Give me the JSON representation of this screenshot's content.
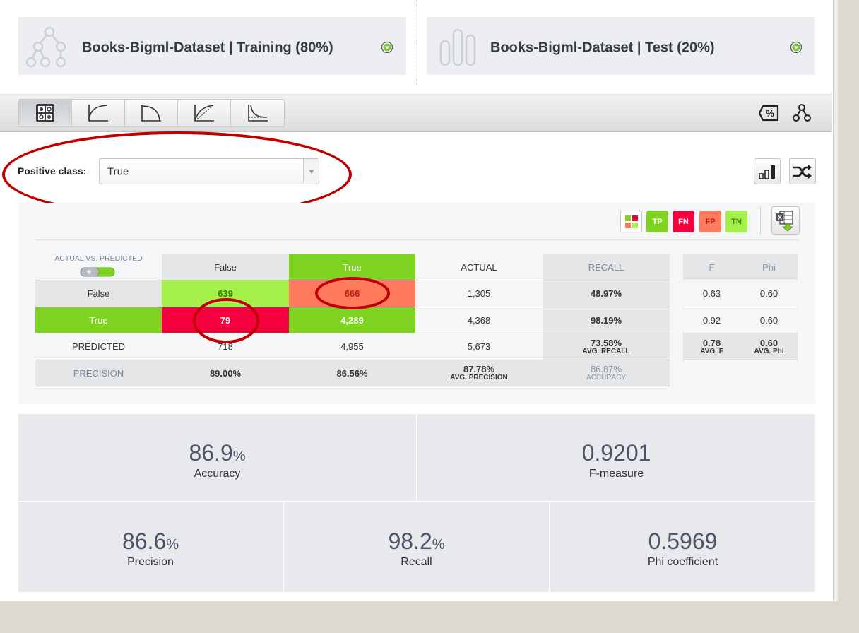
{
  "datasets": {
    "training": {
      "name": "Books-Bigml-Dataset | Training (80%)",
      "icon": "model-tree-icon"
    },
    "test": {
      "name": "Books-Bigml-Dataset | Test (20%)",
      "icon": "dataset-bars-icon"
    }
  },
  "toolbar": {
    "tabs": [
      "confusion-matrix-icon",
      "roc-curve-icon",
      "precision-recall-curve-icon",
      "gain-curve-icon",
      "lift-curve-icon"
    ],
    "active_tab": 0,
    "right_icons": [
      "percentage-icon",
      "model-network-icon"
    ]
  },
  "positive_class": {
    "label": "Positive class:",
    "value": "True"
  },
  "legend": {
    "all": "all-quadrants-icon",
    "tp": "TP",
    "fn": "FN",
    "fp": "FP",
    "tn": "TN",
    "colors": {
      "tp": "#7ed321",
      "fn": "#f5003f",
      "fp": "#ff7b5c",
      "tn": "#a6f04a"
    }
  },
  "matrix": {
    "toggle_label": "ACTUAL VS. PREDICTED",
    "col_headers": [
      "False",
      "True"
    ],
    "actual_header": "ACTUAL",
    "recall_header": "RECALL",
    "rows": [
      {
        "label": "False",
        "cells": [
          "639",
          "666"
        ],
        "actual": "1,305",
        "recall": "48.97%"
      },
      {
        "label": "True",
        "cells": [
          "79",
          "4,289"
        ],
        "actual": "4,368",
        "recall": "98.19%"
      }
    ],
    "predicted": {
      "label": "PREDICTED",
      "cells": [
        "718",
        "4,955"
      ],
      "total": "5,673",
      "avg_recall": "73.58%",
      "avg_recall_label": "AVG. RECALL"
    },
    "precision": {
      "label": "PRECISION",
      "cells": [
        "89.00%",
        "86.56%"
      ],
      "avg_precision": "87.78%",
      "avg_precision_label": "AVG. PRECISION",
      "accuracy": "86.87%",
      "accuracy_label": "ACCURACY"
    },
    "side": {
      "headers": [
        "F",
        "Phi"
      ],
      "rows": [
        [
          "0.63",
          "0.60"
        ],
        [
          "0.92",
          "0.60"
        ]
      ],
      "avg": {
        "f": "0.78",
        "f_label": "AVG. F",
        "phi": "0.60",
        "phi_label": "AVG. Phi"
      }
    }
  },
  "metrics": {
    "accuracy": {
      "value": "86.9",
      "unit": "%",
      "label": "Accuracy"
    },
    "f_measure": {
      "value": "0.9201",
      "unit": "",
      "label": "F-measure"
    },
    "precision": {
      "value": "86.6",
      "unit": "%",
      "label": "Precision"
    },
    "recall": {
      "value": "98.2",
      "unit": "%",
      "label": "Recall"
    },
    "phi": {
      "value": "0.5969",
      "unit": "",
      "label": "Phi coefficient"
    }
  },
  "annotation_color": "#c00000"
}
